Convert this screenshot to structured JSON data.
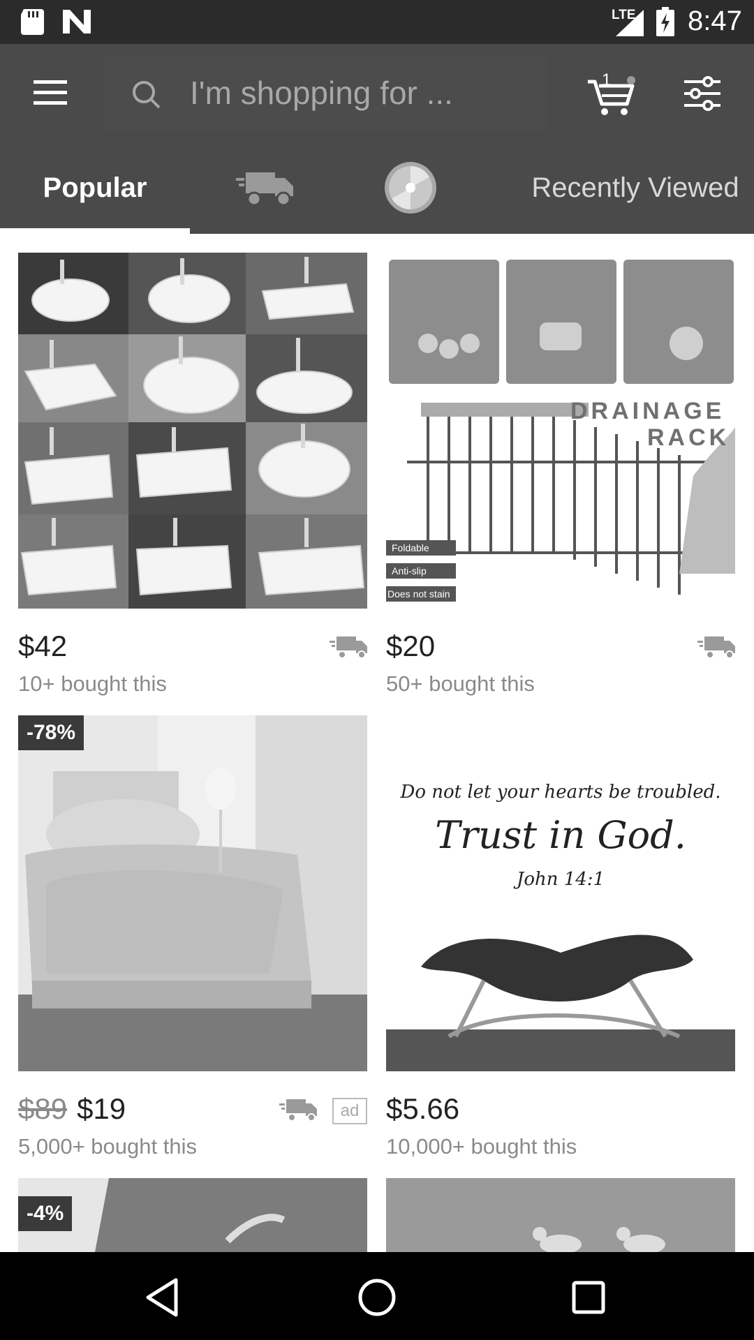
{
  "status_bar": {
    "network": "LTE",
    "time": "8:47",
    "icons": [
      "sd-card-icon",
      "n-logo-icon",
      "signal-icon",
      "battery-charging-icon"
    ]
  },
  "header": {
    "search_placeholder": "I'm shopping for ...",
    "cart_count": "1",
    "icons": [
      "menu-icon",
      "search-icon",
      "cart-icon",
      "filter-icon"
    ]
  },
  "tabs": [
    {
      "label": "Popular",
      "selected": true
    },
    {
      "icon": "delivery-truck-icon"
    },
    {
      "icon": "spin-wheel-icon"
    },
    {
      "label": "Recently Viewed",
      "selected": false
    }
  ],
  "products": [
    {
      "price": "$42",
      "bought": "10+ bought this",
      "shipping_icon": "fast-shipping-icon"
    },
    {
      "price": "$20",
      "bought": "50+ bought this",
      "shipping_icon": "fast-shipping-icon",
      "image_text": {
        "title_line1": "DRAINAGE",
        "title_line2": "RACK",
        "features": [
          "Foldable",
          "Anti-slip",
          "Does not stain"
        ]
      }
    },
    {
      "old_price": "$89",
      "price": "$19",
      "bought": "5,000+ bought this",
      "discount": "-78%",
      "shipping_icon": "fast-shipping-icon",
      "ad_label": "ad"
    },
    {
      "price": "$5.66",
      "bought": "10,000+ bought this",
      "image_text": {
        "line1": "Do not let your hearts be troubled.",
        "line2": "Trust in God.",
        "line3": "John 14:1"
      }
    },
    {
      "discount": "-4%"
    },
    {}
  ],
  "colors": {
    "status_bar": "#2b2b2b",
    "header": "#4a4a4a",
    "nav_bar": "#000000",
    "discount_badge": "#3a3a3a"
  }
}
